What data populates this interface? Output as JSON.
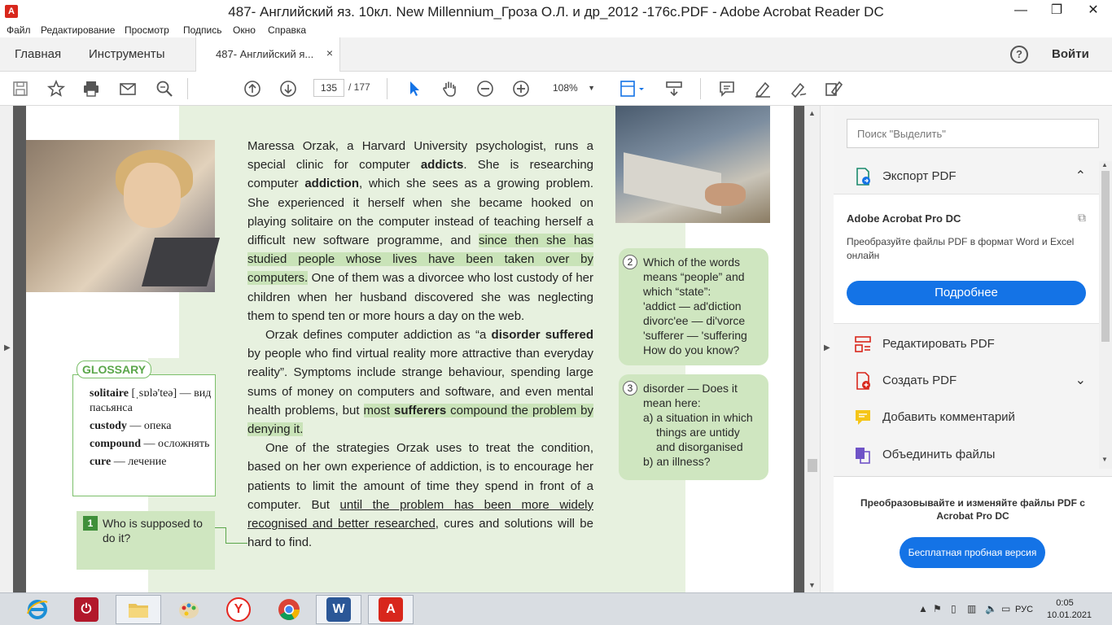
{
  "window": {
    "title": "487- Английский яз. 10кл. New Millennium_Гроза О.Л. и др_2012 -176с.PDF - Adobe Acrobat Reader DC",
    "app_icon": "А",
    "minimize": "—",
    "maximize": "❐",
    "close": "✕"
  },
  "menu": [
    "Файл",
    "Редактирование",
    "Просмотр",
    "Подпись",
    "Окно",
    "Справка"
  ],
  "tabs": {
    "home": "Главная",
    "tools": "Инструменты",
    "document": "487- Английский я...",
    "close": "×",
    "help": "?",
    "signin": "Войти"
  },
  "toolbar": {
    "page_current": "135",
    "page_total": "/  177",
    "zoom": "108%",
    "zoom_arrow": "▼",
    "icons": [
      "save-icon",
      "bookmark-star-icon",
      "print-icon",
      "email-icon",
      "search-zoom-icon",
      "page-up-icon",
      "page-down-icon",
      "select-cursor-icon",
      "hand-tool-icon",
      "zoom-out-icon",
      "zoom-in-icon",
      "fit-page-icon",
      "scroll-mode-icon",
      "comment-icon",
      "highlight-pen-icon",
      "sign-icon",
      "fill-sign-icon"
    ]
  },
  "document": {
    "paragraph1_a": "Maressa Orzak, a Harvard University psychologist, runs a special clinic for computer ",
    "paragraph1_b": "addicts",
    "paragraph1_c": ". She is researching computer ",
    "paragraph1_d": "addiction",
    "paragraph1_e": ", which she sees as a growing problem. She experienced it herself when she became hooked on playing solitaire on the computer instead of teaching herself a difficult new software programme, and ",
    "paragraph1_hl": "since then she has studied people whose lives have been taken over by computers.",
    "paragraph1_f": " One of them was a divorcee who lost custody of her children when her husband discovered she was neglecting them to spend ten or more hours a day on the web.",
    "paragraph2_a": "Orzak defines computer addiction as “a ",
    "paragraph2_b": "disorder suffered",
    "paragraph2_c": " by people who find virtual reality more attractive than everyday reality”. Symptoms include strange behaviour, spending large sums of money on computers and software, and even mental health problems, but ",
    "paragraph2_hl1": "most ",
    "paragraph2_hl2": "sufferers",
    "paragraph2_hl3": " compound the problem by denying it.",
    "paragraph3_a": "One of the strategies Orzak uses to treat the condition, based on her own experience of addiction, is to encourage her patients to limit the amount of time they spend in front of a computer. But ",
    "paragraph3_ul": "until the problem has been more widely recognised and better researched",
    "paragraph3_b": ", cures and solutions will be hard to find.",
    "glossary_title": "GLOSSARY",
    "glossary": [
      {
        "term": "solitaire",
        "def": " [ˌsɒlə'teə] — вид пасьянса"
      },
      {
        "term": "custody",
        "def": " — опека"
      },
      {
        "term": "compound",
        "def": " — осложнять"
      },
      {
        "term": "cure",
        "def": " — лечение"
      }
    ],
    "q1_num": "1",
    "q1_text": "Who is supposed to do it?",
    "q2_num": "2",
    "q2_lines": [
      "Which of the words means “people” and which “state”:",
      "'addict — ad'diction",
      "divorc'ee — di'vorce",
      "'sufferer — 'suffering",
      "How do you know?"
    ],
    "q3_num": "3",
    "q3_lines": [
      "disorder — Does it mean here:",
      "a) a situation in which",
      "things are untidy",
      "and disorganised",
      "b) an illness?"
    ]
  },
  "right_panel": {
    "search_placeholder": "Поиск \"Выделить\"",
    "export_pdf": "Экспорт PDF",
    "promo_title": "Adobe Acrobat Pro DC",
    "promo_desc": "Преобразуйте файлы PDF в формат Word и Excel онлайн",
    "promo_button": "Подробнее",
    "tools": [
      "Редактировать PDF",
      "Создать PDF",
      "Добавить комментарий",
      "Объединить файлы"
    ],
    "bottom_text": "Преобразовывайте и изменяйте файлы PDF с Acrobat Pro DC",
    "trial_button": "Бесплатная пробная версия"
  },
  "taskbar": {
    "apps": [
      "internet-explorer",
      "power",
      "file-explorer",
      "paint",
      "yandex-browser",
      "chrome",
      "word",
      "acrobat"
    ],
    "lang": "РУС",
    "time": "0:05",
    "date": "10.01.2021"
  },
  "colors": {
    "accent_blue": "#1473e6",
    "page_green": "#e7f1df",
    "highlight_green": "#c9e3b8",
    "acrobat_red": "#d8271c"
  }
}
